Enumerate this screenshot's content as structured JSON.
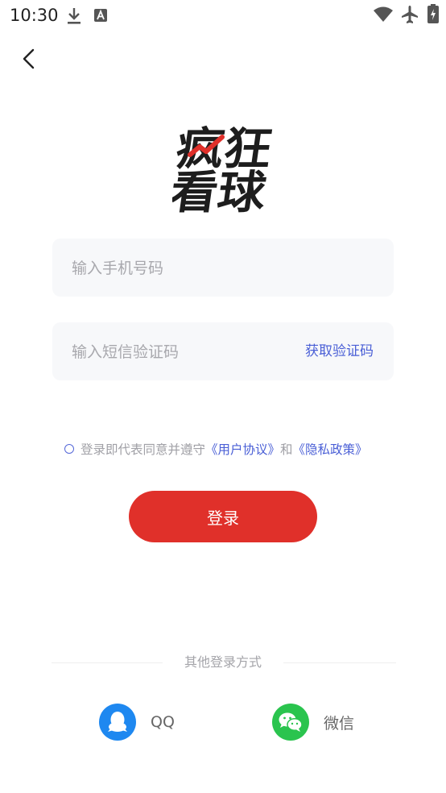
{
  "status_bar": {
    "time": "10:30",
    "icons": [
      "download-icon",
      "text-a-icon",
      "wifi-icon",
      "airplane-icon",
      "battery-icon"
    ]
  },
  "header": {
    "back_icon": "chevron-left-icon"
  },
  "logo": {
    "text_line1": "疯狂",
    "text_line2": "看球"
  },
  "form": {
    "phone_placeholder": "输入手机号码",
    "code_placeholder": "输入短信验证码",
    "get_code_label": "获取验证码"
  },
  "agreement": {
    "prefix": "登录即代表同意并遵守",
    "user_agreement": "《用户协议》",
    "and": "和",
    "privacy_policy": "《隐私政策》"
  },
  "login_button": "登录",
  "other_login": {
    "title": "其他登录方式",
    "qq_label": "QQ",
    "wechat_label": "微信"
  },
  "colors": {
    "accent_red": "#e0302a",
    "link_blue": "#4a5fd6",
    "qq_blue": "#1e88f0",
    "wechat_green": "#2ac44e",
    "input_bg": "#f7f8fa"
  }
}
